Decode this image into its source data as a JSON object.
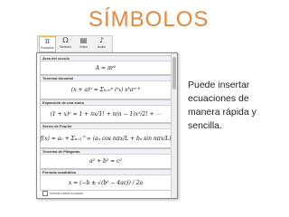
{
  "slide": {
    "title": "SÍMBOLOS",
    "description": "Puede insertar ecuaciones de manera rápida y sencilla."
  },
  "ribbon": {
    "buttons": [
      {
        "icon": "π",
        "label": "Ecuación",
        "active": true
      },
      {
        "icon": "Ω",
        "label": "Símbolo",
        "active": false
      },
      {
        "icon": "▤",
        "label": "Vídeo",
        "active": false
      },
      {
        "icon": "♪",
        "label": "Audio",
        "active": false
      }
    ]
  },
  "gallery": {
    "items": [
      {
        "heading": "Área del círculo",
        "equation": "A = πr²"
      },
      {
        "heading": "Teorema binomial",
        "equation": "(x + a)ⁿ = Σₖ₌₀ⁿ (ⁿₖ) xᵏaⁿ⁻ᵏ"
      },
      {
        "heading": "Expansión de una suma",
        "equation": "(1 + x)ⁿ = 1 + nx/1! + n(n − 1)x²/2! + ⋯"
      },
      {
        "heading": "Series de Fourier",
        "equation": "f(x) = a₀ + Σₙ₌₁^∞ (aₙ cos nπx/L + bₙ sin nπx/L)"
      },
      {
        "heading": "Teorema de Pitágoras",
        "equation": "a² + b² = c²"
      },
      {
        "heading": "Fórmula cuadrática",
        "equation": "x = (−b ± √(b² − 4ac)) / 2a"
      }
    ],
    "more_label": "Insertar nueva ecuación"
  }
}
